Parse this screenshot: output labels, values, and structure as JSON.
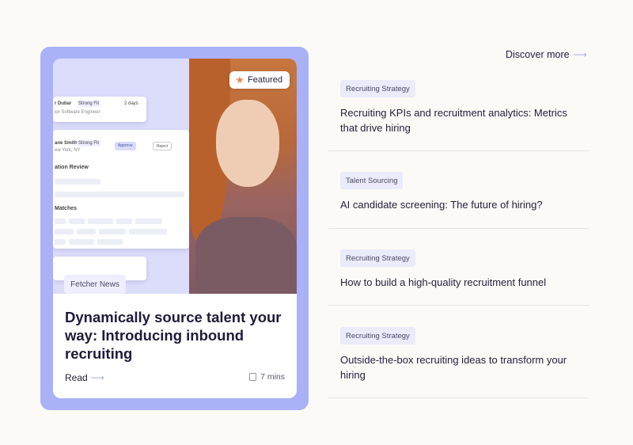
{
  "featured": {
    "badge_label": "Featured",
    "badge_icon": "star-icon",
    "category": "Fetcher News",
    "title": "Dynamically source talent your way: Introducing inbound recruiting",
    "read_label": "Read",
    "read_time": "7 mins",
    "mock_ui": {
      "card_a_name": "r Dubar",
      "card_a_tag": "Strong Fit",
      "card_a_time": "2 days",
      "card_a_role": "ior Software Engineer",
      "card_b_name": "ane Smith",
      "card_b_tag": "Strong Fit",
      "card_b_sub": "ew York, NY",
      "card_b_approve": "Approve",
      "card_b_reject": "Reject",
      "card_b_section": "ation Review",
      "card_b_matches": "Matches"
    }
  },
  "discover_label": "Discover more",
  "articles": [
    {
      "tag": "Recruiting Strategy",
      "title": "Recruiting KPIs and recruitment analytics: Metrics that drive hiring"
    },
    {
      "tag": "Talent Sourcing",
      "title": "AI candidate screening: The future of hiring?"
    },
    {
      "tag": "Recruiting Strategy",
      "title": "How to build a high-quality recruitment funnel"
    },
    {
      "tag": "Recruiting Strategy",
      "title": "Outside-the-box recruiting ideas to transform your hiring"
    }
  ],
  "colors": {
    "accent": "#aab1f7",
    "star": "#f37b4b",
    "tag_bg": "#eaebfb",
    "text": "#26213f"
  }
}
